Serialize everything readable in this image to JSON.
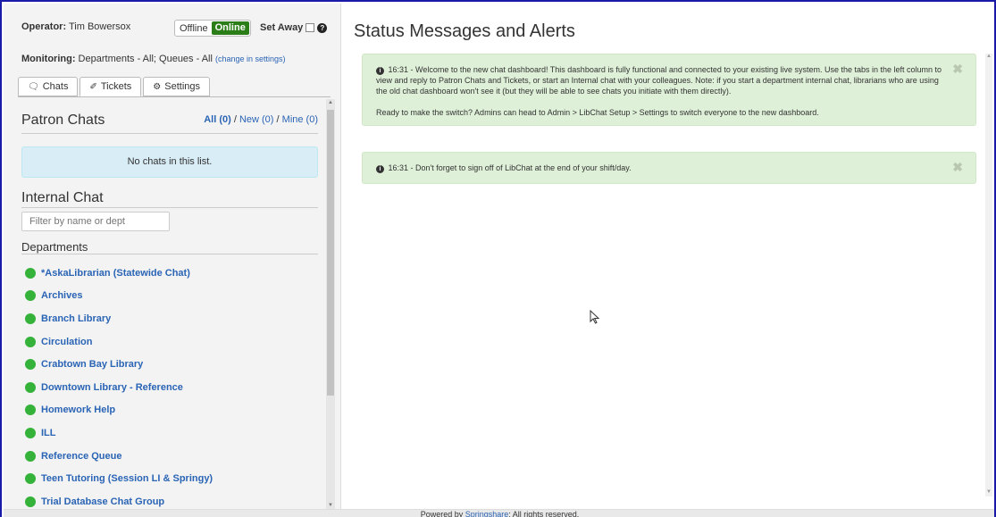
{
  "operator": {
    "label": "Operator:",
    "name": "Tim Bowersox"
  },
  "status": {
    "offline_label": "Offline",
    "online_label": "Online",
    "set_away_label": "Set Away"
  },
  "monitoring": {
    "label": "Monitoring:",
    "value": "Departments - All; Queues - All",
    "change_link": "(change in settings)"
  },
  "tabs": [
    {
      "label": "Chats",
      "icon": "chat-bubble-icon"
    },
    {
      "label": "Tickets",
      "icon": "ticket-icon"
    },
    {
      "label": "Settings",
      "icon": "gear-icon"
    }
  ],
  "patron_chats": {
    "title": "Patron Chats",
    "filter_all": "All (0)",
    "filter_new": "New (0)",
    "filter_mine": "Mine (0)",
    "separator": "/",
    "empty_message": "No chats in this list."
  },
  "internal_chat": {
    "title": "Internal Chat",
    "filter_placeholder": "Filter by name or dept",
    "departments_title": "Departments",
    "departments": [
      "*AskaLibrarian (Statewide Chat)",
      "Archives",
      "Branch Library",
      "Circulation",
      "Crabtown Bay Library",
      "Downtown Library - Reference",
      "Homework Help",
      "ILL",
      "Reference Queue",
      "Teen Tutoring (Session LI & Springy)",
      "Trial Database Chat Group"
    ],
    "online_color": "#34b23a"
  },
  "main": {
    "title": "Status Messages and Alerts",
    "alerts": [
      {
        "paragraphs": [
          "16:31 - Welcome to the new chat dashboard! This dashboard is fully functional and connected to your existing live system. Use the tabs in the left column to view and reply to Patron Chats and Tickets, or start an Internal chat with your colleagues. Note: if you start a department internal chat, librarians who are using the old chat dashboard won't see it (but they will be able to see chats you initiate with them directly).",
          "Ready to make the switch? Admins can head to Admin > LibChat Setup > Settings to switch everyone to the new dashboard."
        ]
      },
      {
        "paragraphs": [
          "16:31 - Don't forget to sign off of LibChat at the end of your shift/day."
        ]
      }
    ],
    "alert_color": "#dff0d8"
  },
  "footer": {
    "prefix": "Powered by",
    "link": "Springshare",
    "suffix": "; All rights reserved."
  }
}
